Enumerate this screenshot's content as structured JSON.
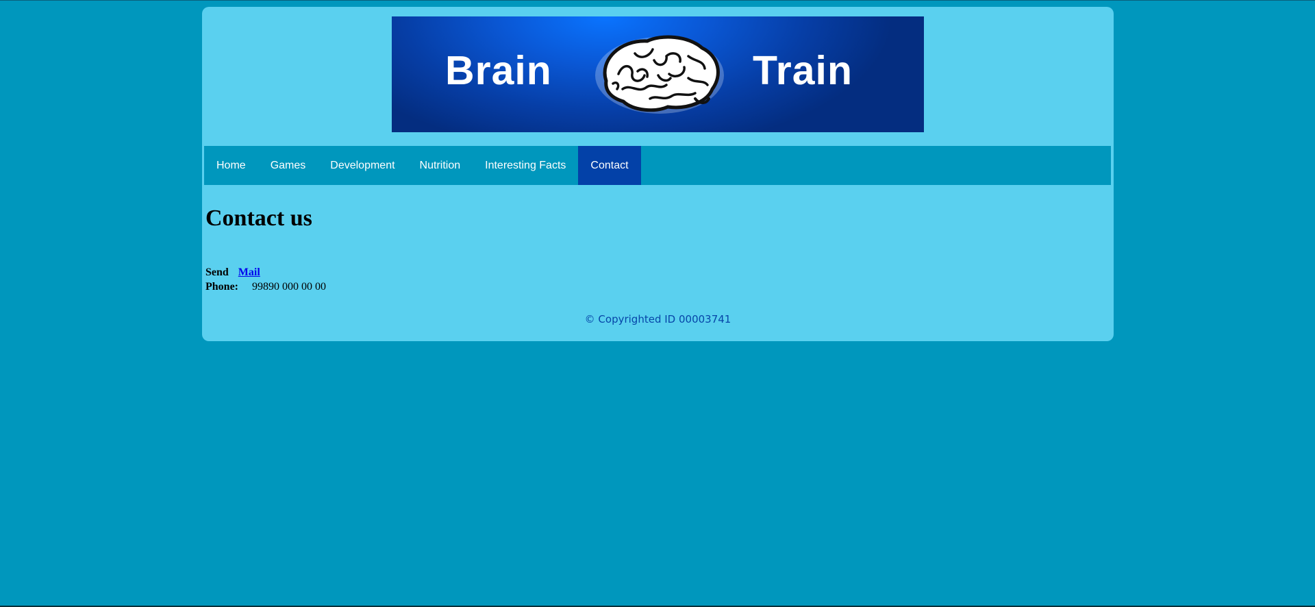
{
  "header": {
    "banner_left_word": "Brain",
    "banner_right_word": "Train",
    "logo_icon": "brain-icon"
  },
  "nav": {
    "items": [
      {
        "label": "Home"
      },
      {
        "label": "Games"
      },
      {
        "label": "Development"
      },
      {
        "label": "Nutrition"
      },
      {
        "label": "Interesting Facts"
      },
      {
        "label": "Contact",
        "active": true
      }
    ]
  },
  "main": {
    "title": "Contact us",
    "send_label": "Send",
    "mail_link": "Mail",
    "phone_label": "Phone:",
    "phone_value": "99890 000 00 00"
  },
  "footer": {
    "copyright": "© Copyrighted ID 00003741"
  },
  "colors": {
    "page_background": "#0097bd",
    "container_background": "#5ad0ef",
    "nav_background": "#0097bd",
    "nav_active": "#0341a8",
    "banner": "#0a58d6",
    "link": "#0000ee",
    "copyright_text": "#0645a8"
  }
}
